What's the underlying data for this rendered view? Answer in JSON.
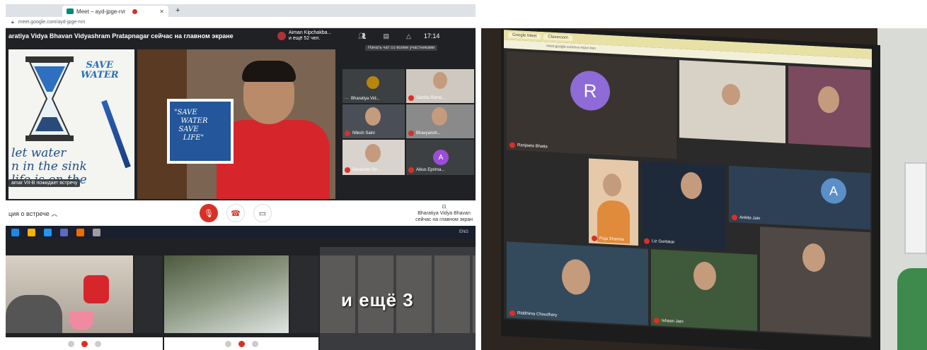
{
  "left": {
    "browser_tab": "Meet – ayd-jpge-rvr",
    "url": "meet.google.com/ayd-jpge-rvn",
    "presenting": "aratiya Vidya Bhavan Vidyashram Pratapnagar сейчас на главном экране",
    "user_name": "Aiman Kipchakba...",
    "user_others": "и ещё 52 чел.",
    "clock": "17:14",
    "tooltip": "Начать чат со всеми участниками",
    "poster": {
      "title": "SAVE\nWATER",
      "phrase": "let water\nn in the sink\nlife is on the"
    },
    "card_text": "\"SAVE\n   WATER\n  SAVE\n    LIFE\"",
    "waiting_label": "amar VII-B пожидает встречу",
    "participants": [
      {
        "name": "Bharatiya Vid..."
      },
      {
        "name": "Samita Rame..."
      },
      {
        "name": "Nilesh Saini"
      },
      {
        "name": "Bhavyansh..."
      },
      {
        "name": "Devanshi Sin..."
      },
      {
        "name": "Aikus Eprima..."
      }
    ],
    "avatar_letter": "A",
    "meeting_info": "ция о встрече",
    "presenter_info": "Bharatiya Vidya Bhavan\nсейчас на главном экран",
    "more_label": "и ещё 3",
    "tray": "ENG"
  },
  "right": {
    "tab1": "Google Meet",
    "tab2": "Classroom",
    "url": "meet.google.com/xvz-mpvr-hen",
    "participants": [
      {
        "name": "Ranjeeta Bhatia",
        "letter": "R"
      },
      {
        "name": "Puja Sharma"
      },
      {
        "name": "Liz Gorlokar"
      },
      {
        "name": "Riddhima Choudhary"
      },
      {
        "name": "Ishaan Jain"
      },
      {
        "name": "Ankita Jain",
        "letter": "A"
      }
    ]
  },
  "colors": {
    "mic_red": "#d93025",
    "avatar_purple": "#9c4dd6",
    "avatar_R": "#8e6bd6",
    "avatar_A_blue": "#5a8fc7"
  }
}
